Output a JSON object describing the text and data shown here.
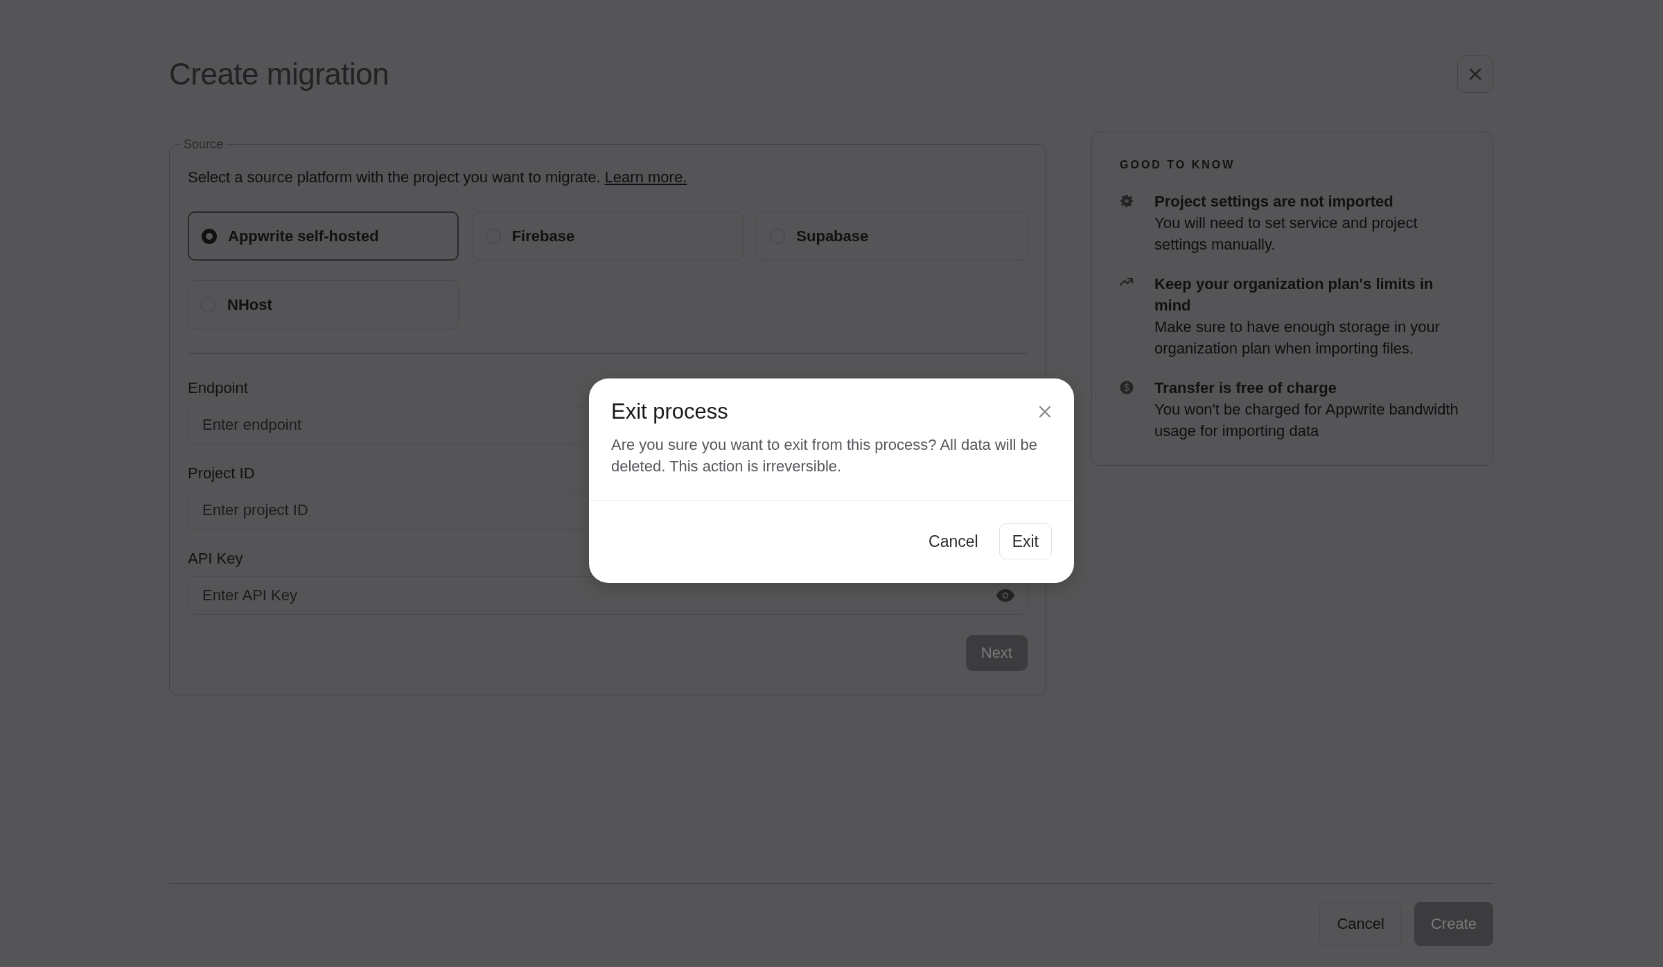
{
  "page": {
    "title": "Create migration"
  },
  "source": {
    "legend": "Source",
    "description": "Select a source platform with the project you want to migrate.",
    "link": "Learn more.",
    "platforms": [
      {
        "label": "Appwrite self-hosted",
        "selected": true
      },
      {
        "label": "Firebase",
        "selected": false
      },
      {
        "label": "Supabase",
        "selected": false
      },
      {
        "label": "NHost",
        "selected": false
      }
    ],
    "fields": [
      {
        "label": "Endpoint",
        "placeholder": "Enter endpoint",
        "visibility_toggle": false
      },
      {
        "label": "Project ID",
        "placeholder": "Enter project ID",
        "visibility_toggle": false
      },
      {
        "label": "API Key",
        "placeholder": "Enter API Key",
        "visibility_toggle": true
      }
    ],
    "next_button": {
      "label": "Next",
      "disabled": true
    }
  },
  "good_to_know": {
    "heading": "GOOD TO KNOW",
    "tips": [
      {
        "kind": "gear",
        "title": "Project settings are not imported",
        "text": "You will need to set service and project settings manually."
      },
      {
        "kind": "trend",
        "title": "Keep your organization plan's limits in mind",
        "text": "Make sure to have enough storage in your organization plan when importing files."
      },
      {
        "kind": "dollar",
        "title": "Transfer is free of charge",
        "text": "You won't be charged for Appwrite bandwidth usage for importing data"
      }
    ]
  },
  "footer": {
    "cancel": "Cancel",
    "create": {
      "label": "Create",
      "disabled": true
    }
  },
  "dialog": {
    "title": "Exit process",
    "message": "Are you sure you want to exit from this process? All data will be deleted. This action is irreversible.",
    "cancel": "Cancel",
    "confirm": "Exit"
  }
}
